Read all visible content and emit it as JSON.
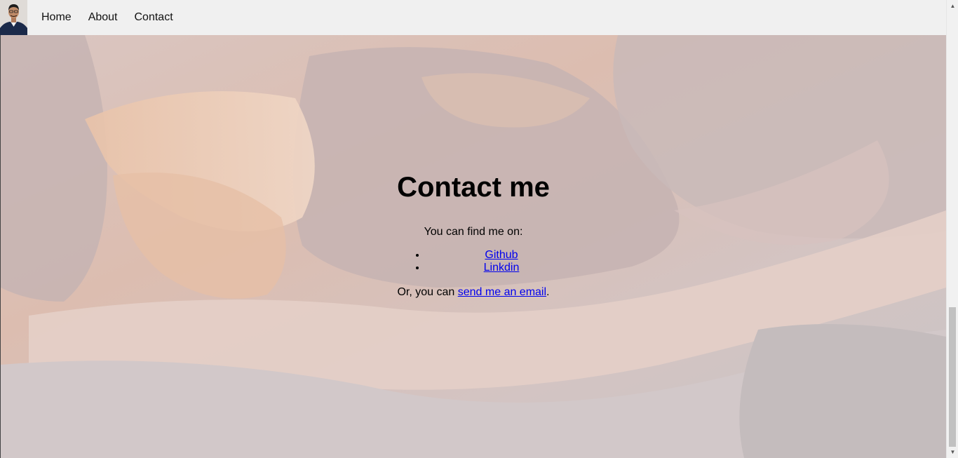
{
  "nav": {
    "items": [
      {
        "label": "Home"
      },
      {
        "label": "About"
      },
      {
        "label": "Contact"
      }
    ]
  },
  "page": {
    "title": "Contact me",
    "intro": "You can find me on:",
    "links": [
      {
        "label": "Github"
      },
      {
        "label": "Linkdin"
      }
    ],
    "outro_prefix": "Or, you can ",
    "email_link": "send me an email",
    "outro_suffix": "."
  },
  "colors": {
    "nav_background": "#f0f0f0",
    "link": "#0000ee",
    "text": "#000000"
  },
  "icons": {
    "avatar": "profile-photo",
    "scroll_up": "arrow-up-icon",
    "scroll_down": "arrow-down-icon"
  }
}
